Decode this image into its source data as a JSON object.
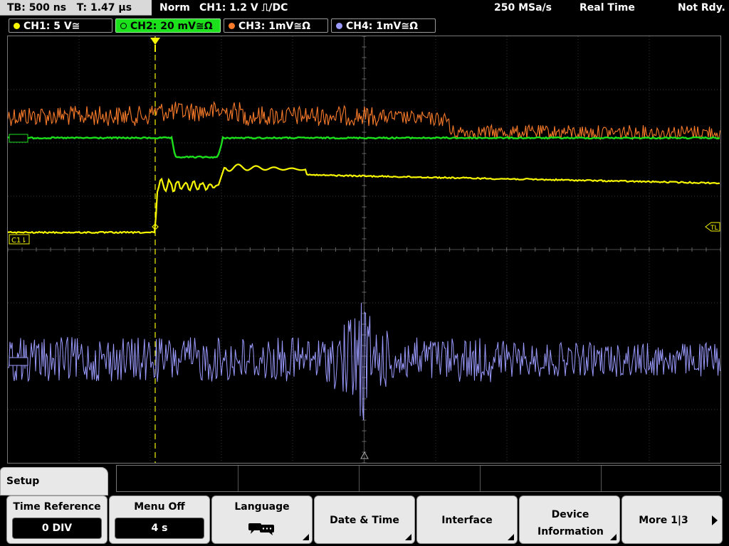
{
  "topbar": {
    "timebase": "TB: 500 ns",
    "trigger_time": "T: 1.47 µs",
    "mode": "Norm",
    "trigger": "CH1: 1.2 V ⎍/DC",
    "sample_rate": "250 MSa/s",
    "acq_mode": "Real Time",
    "status": "Not Rdy."
  },
  "channels": [
    {
      "label": "CH1: 5 V≅",
      "color": "#f6f600"
    },
    {
      "label": "CH2: 20 mV≅Ω",
      "color": "#1de01d",
      "active": true
    },
    {
      "label": "CH3: 1mV≅Ω",
      "color": "#f97b2a"
    },
    {
      "label": "CH4: 1mV≅Ω",
      "color": "#9b9bff"
    }
  ],
  "markers": {
    "ch1_ref": "C1⇂",
    "trigger_level": "TL"
  },
  "menu": {
    "title": "Setup",
    "softkeys": [
      {
        "label": "Time Reference",
        "value": "0 DIV"
      },
      {
        "label": "Menu Off",
        "value": "4 s"
      },
      {
        "label": "Language",
        "icon": "speech-bubbles-icon"
      },
      {
        "label": "Date & Time"
      },
      {
        "label": "Interface"
      },
      {
        "label": "Device Information"
      },
      {
        "label": "More 1|3"
      }
    ]
  },
  "colors": {
    "ch1": "#f6f600",
    "ch2": "#1de01d",
    "ch3": "#f97b2a",
    "ch4": "#9b9bff",
    "trigger_marker": "#f6f600"
  }
}
